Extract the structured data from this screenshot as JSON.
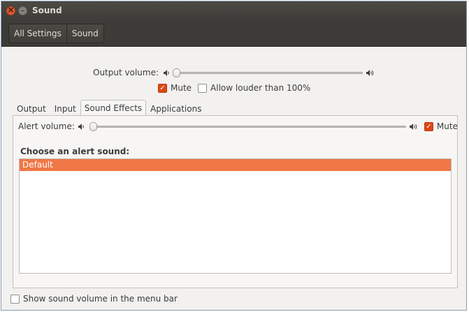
{
  "window": {
    "title": "Sound"
  },
  "toolbar": {
    "crumbs": [
      "All Settings",
      "Sound"
    ]
  },
  "output": {
    "label": "Output volume:",
    "level": 0,
    "mute_label": "Mute",
    "mute_checked": true,
    "louder_label": "Allow louder than 100%",
    "louder_checked": false
  },
  "tabs": [
    "Output",
    "Input",
    "Sound Effects",
    "Applications"
  ],
  "active_tab": "Sound Effects",
  "effects": {
    "alert_label": "Alert volume:",
    "alert_level": 0,
    "mute_label": "Mute",
    "mute_checked": true,
    "choose_label": "Choose an alert sound:",
    "sounds": [
      "Default"
    ],
    "selected_sound": "Default"
  },
  "footer": {
    "menu_bar_label": "Show sound volume in the menu bar",
    "menu_bar_checked": false
  },
  "colors": {
    "accent": "#dd4814",
    "selection": "#f07746"
  },
  "icons": {
    "close": "close-icon",
    "minimize": "minimize-icon",
    "volume_low": "speaker-low-icon",
    "volume_high": "speaker-high-icon",
    "check": "checkmark-icon"
  }
}
